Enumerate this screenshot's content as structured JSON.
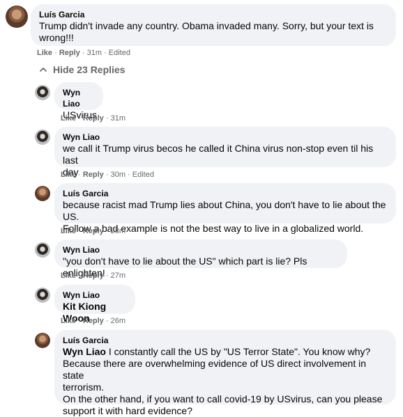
{
  "common": {
    "like": "Like",
    "reply": "Reply",
    "dot": "·",
    "edited": "Edited"
  },
  "hide_replies": "Hide 23 Replies",
  "comments": [
    {
      "name": "Luís Garcia",
      "text": "Trump didn't invade any country. Obama invaded many. Sorry, but your text is\nwrong!!!",
      "time": "31m",
      "edited": true
    },
    {
      "name": "Wyn Liao",
      "text": "USvirus",
      "time": "31m"
    },
    {
      "name": "Wyn Liao",
      "text": "we call it Trump virus becos he called it China virus non-stop even til his last\nday",
      "time": "30m",
      "edited": true
    },
    {
      "name": "Luís Garcia",
      "text": "because racist mad Trump lies about China, you don't have to lie about the US.\nFollow a bad example is not the best way to live in a globalized world.",
      "time": "28m"
    },
    {
      "name": "Wyn Liao",
      "text": "\"you don't have to lie about the US\" which part is lie? Pls enlighten!",
      "time": "27m"
    },
    {
      "name": "Wyn Liao",
      "mention": "Kit Kiong Woon",
      "time": "26m"
    },
    {
      "name": "Luís Garcia",
      "mention": "Wyn Liao",
      "text": " I constantly call the US by \"US Terror State\". You know why?\nBecause there are overwhelming evidence of US direct involvement in state\nterrorism.\nOn the other hand, if you want to call covid-19 by USvirus, can you please\nsupport it with hard evidence?"
    }
  ]
}
